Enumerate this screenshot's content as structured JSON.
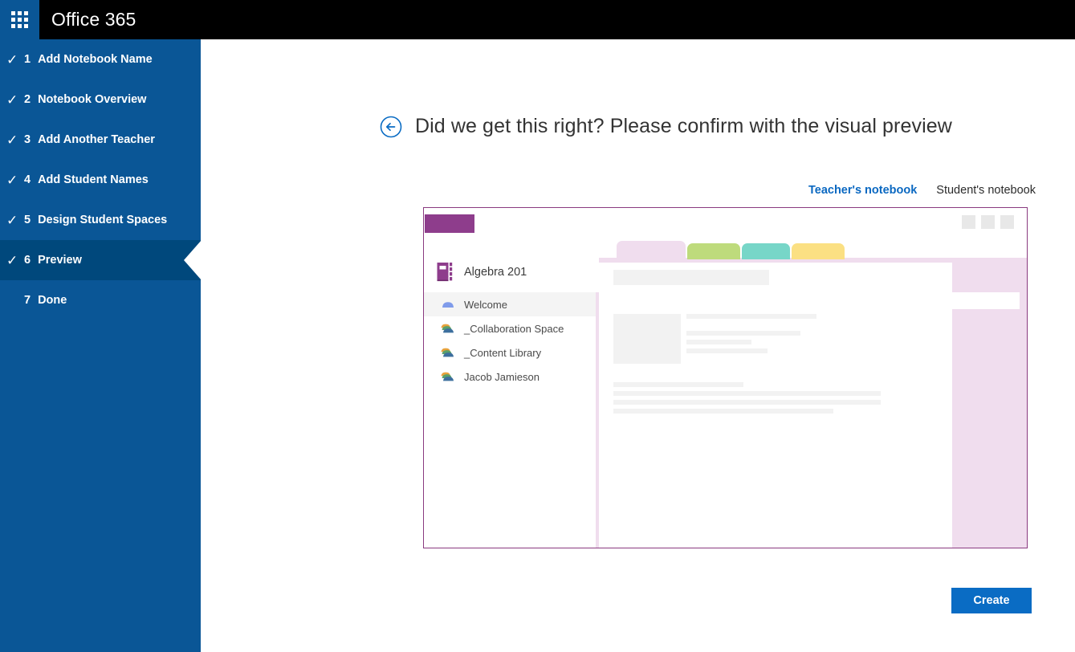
{
  "suite": {
    "app_launcher_icon": "waffle-grid-icon",
    "title": "Office 365"
  },
  "wizard": {
    "steps": [
      {
        "number": "1",
        "label": "Add Notebook Name",
        "check": "✓",
        "state": "complete"
      },
      {
        "number": "2",
        "label": "Notebook Overview",
        "check": "✓",
        "state": "complete"
      },
      {
        "number": "3",
        "label": "Add Another Teacher",
        "check": "✓",
        "state": "complete"
      },
      {
        "number": "4",
        "label": "Add Student Names",
        "check": "✓",
        "state": "complete"
      },
      {
        "number": "5",
        "label": "Design Student Spaces",
        "check": "✓",
        "state": "complete"
      },
      {
        "number": "6",
        "label": "Preview",
        "check": "✓",
        "state": "active"
      },
      {
        "number": "7",
        "label": "Done",
        "check": "",
        "state": "upcoming"
      }
    ]
  },
  "header": {
    "back_icon": "back-arrow-circle-icon",
    "title": "Did we get this right? Please confirm with the visual preview"
  },
  "notebook_tabs": [
    {
      "label": "Teacher's notebook",
      "selected": true
    },
    {
      "label": "Student's notebook",
      "selected": false
    }
  ],
  "preview": {
    "window_controls": [
      "minimize",
      "maximize",
      "close"
    ],
    "notebook_icon": "notebook-book-icon",
    "notebook_name": "Algebra 201",
    "sections": [
      {
        "label": "Welcome",
        "icon": "section-tab-icon",
        "selected": true
      },
      {
        "label": "_Collaboration Space",
        "icon": "section-group-icon",
        "selected": false
      },
      {
        "label": "_Content Library",
        "icon": "section-group-icon",
        "selected": false
      },
      {
        "label": "Jacob Jamieson",
        "icon": "section-group-icon",
        "selected": false
      }
    ],
    "section_tab_colors": [
      "#f0ddee",
      "#bedb7c",
      "#77d6c8",
      "#fbe083"
    ],
    "accent_color": "#8e3d8c",
    "frame_border_color": "#8a3a80"
  },
  "footer": {
    "create_label": "Create"
  },
  "colors": {
    "suite_bar": "#000000",
    "rail": "#0a5696",
    "rail_active": "#00487c",
    "primary_button": "#0a6cc4",
    "tab_selected_text": "#0a68c1"
  }
}
